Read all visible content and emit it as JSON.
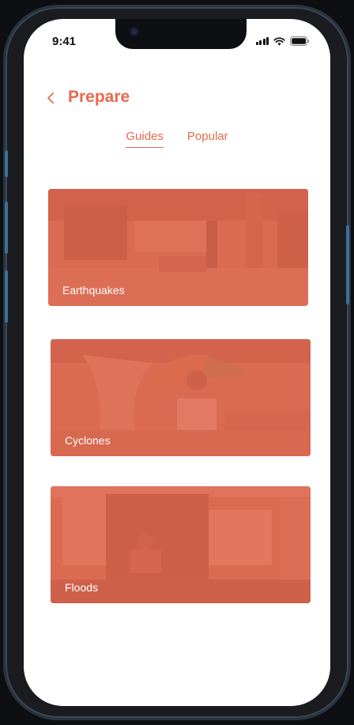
{
  "status_bar": {
    "time": "9:41",
    "icons": [
      "cellular-signal-icon",
      "wifi-icon",
      "battery-icon"
    ]
  },
  "header": {
    "back_icon": "chevron-left-icon",
    "title": "Prepare"
  },
  "tabs": [
    {
      "label": "Guides",
      "active": true
    },
    {
      "label": "Popular",
      "active": false
    }
  ],
  "cards": [
    {
      "label": "Earthquakes"
    },
    {
      "label": "Cyclones"
    },
    {
      "label": "Floods"
    }
  ],
  "colors": {
    "accent": "#e76a4f",
    "overlay": "#e26850",
    "background": "#ffffff",
    "frame": "#1a1c20"
  }
}
